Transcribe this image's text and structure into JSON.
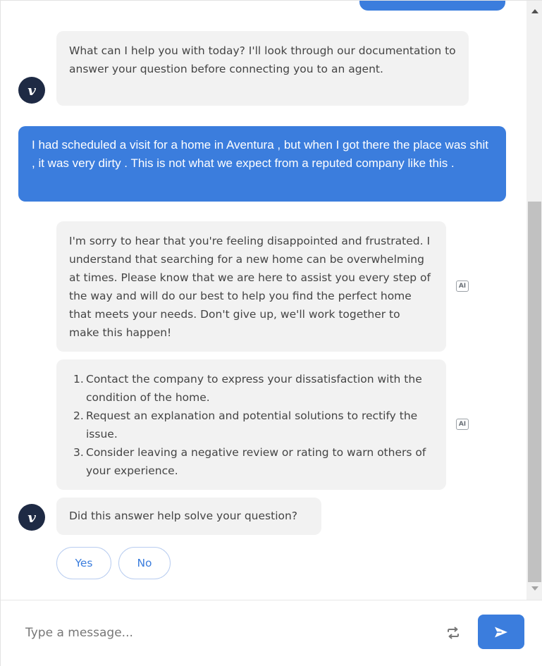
{
  "conversation": {
    "greeting": "What can I help you with today? I'll look through our documentation to answer your question before connecting you to an agent.",
    "user_message": "I had scheduled a visit for a home in Aventura , but when I got there the place was shit , it was very dirty . This is not what we expect from a reputed company like this .",
    "bot_reply_1": "I'm sorry to hear that you're feeling disappointed and frustrated. I understand that searching for a new home can be overwhelming at times. Please know that we are here to assist you every step of the way and will do our best to help you find the perfect home that meets your needs. Don't give up, we'll work together to make this happen!",
    "bot_reply_2_items": [
      "Contact the company to express your dissatisfaction with the condition of the home.",
      "Request an explanation and potential solutions to rectify the issue.",
      "Consider leaving a negative review or rating to warn others of your experience."
    ],
    "feedback_question": "Did this answer help solve your question?",
    "feedback_options": {
      "yes": "Yes",
      "no": "No"
    },
    "ai_badge": "AI",
    "avatar_letter": "v"
  },
  "composer": {
    "placeholder": "Type a message..."
  },
  "colors": {
    "accent": "#3b7ddd",
    "avatar_bg": "#1e2a44",
    "bot_bubble": "#f2f2f2"
  },
  "icons": {
    "avatar": "brand-v-logo-icon",
    "ai": "ai-generated-icon",
    "refresh": "refresh-icon",
    "send": "send-icon"
  }
}
